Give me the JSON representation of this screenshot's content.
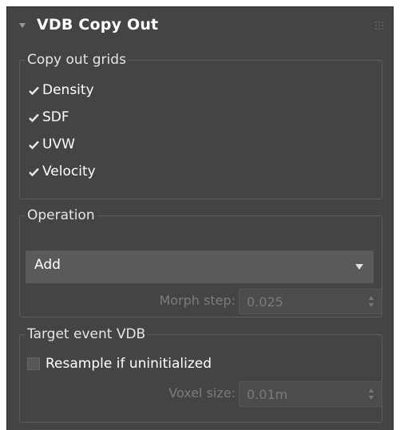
{
  "rollout": {
    "title": "VDB Copy Out",
    "collapse_icon": "triangle-down-icon",
    "grip_icon": "drag-grip-icon"
  },
  "copy_out_grids": {
    "title": "Copy out grids",
    "items": [
      {
        "label": "Density",
        "checked": true
      },
      {
        "label": "SDF",
        "checked": true
      },
      {
        "label": "UVW",
        "checked": true
      },
      {
        "label": "Velocity",
        "checked": true
      }
    ]
  },
  "operation": {
    "title": "Operation",
    "dropdown_value": "Add",
    "morph_step_label": "Morph step:",
    "morph_step_value": "0.025"
  },
  "target_event_vdb": {
    "title": "Target event VDB",
    "resample_label": "Resample if uninitialized",
    "resample_checked": false,
    "voxel_size_label": "Voxel size:",
    "voxel_size_value": "0.01m"
  },
  "colors": {
    "panel_bg": "#444444",
    "group_border": "#5e5e5e",
    "text": "#ffffff",
    "disabled_text": "#7c7c7c",
    "dropdown_bg": "#5a5a5a"
  }
}
